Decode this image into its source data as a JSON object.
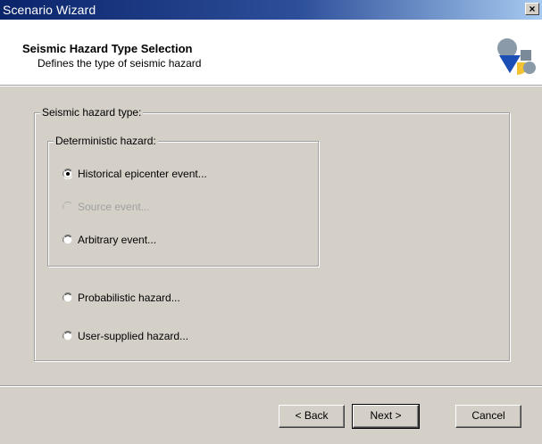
{
  "window": {
    "title": "Scenario Wizard",
    "close_glyph": "×"
  },
  "header": {
    "title": "Seismic Hazard Type Selection",
    "subtitle": "Defines the type of seismic hazard",
    "icon": "wizard-shapes-icon"
  },
  "hazard_group": {
    "label": "Seismic hazard type:",
    "deterministic_group": {
      "label": "Deterministic hazard:",
      "options": [
        {
          "label": "Historical epicenter event...",
          "selected": true,
          "enabled": true
        },
        {
          "label": "Source event...",
          "selected": false,
          "enabled": false
        },
        {
          "label": "Arbitrary event...",
          "selected": false,
          "enabled": true
        }
      ]
    },
    "other_options": [
      {
        "label": "Probabilistic hazard...",
        "selected": false,
        "enabled": true
      },
      {
        "label": "User-supplied hazard...",
        "selected": false,
        "enabled": true
      }
    ]
  },
  "buttons": {
    "back": "< Back",
    "next": "Next >",
    "cancel": "Cancel"
  },
  "colors": {
    "titlebar_start": "#0a246a",
    "titlebar_end": "#a6caf0",
    "dialog_bg": "#d4d0c8",
    "disabled_text": "#a0a0a0"
  }
}
